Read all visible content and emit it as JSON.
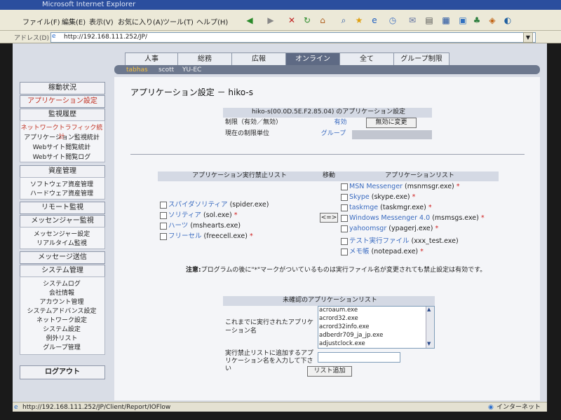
{
  "browser": {
    "title": "Microsoft Internet Explorer",
    "menu": [
      "ファイル(F)",
      "編集(E)",
      "表示(V)",
      "お気に入り(A)",
      "ツール(T)",
      "ヘルプ(H)"
    ],
    "address_label": "アドレス(D)",
    "address": "http://192.168.111.252/JP/",
    "status_url": "http://192.168.111.252/JP/Client/Report/IOFlow",
    "status_zone": "インターネット"
  },
  "tabs": [
    "人事",
    "総務",
    "広報",
    "オンライン",
    "全て",
    "グループ制限"
  ],
  "active_tab": 3,
  "subtabs": [
    "tabhas",
    "scott",
    "YU-EC"
  ],
  "sidebar": {
    "sections": [
      {
        "head": "稼動状況",
        "items": []
      },
      {
        "head": "アプリケーション設定",
        "items": [],
        "red": true
      },
      {
        "head": "監視履歴",
        "items": [
          "ネットワークトラフィック統計",
          "アプリケーション監視統計",
          "Webサイト閲覧統計",
          "Webサイト閲覧ログ"
        ]
      },
      {
        "head": "資産管理",
        "items": [
          "ソフトウェア資産管理",
          "ハードウェア資産管理"
        ]
      },
      {
        "head": "リモート監視",
        "items": []
      },
      {
        "head": "メッセンジャー監視",
        "items": [
          "メッセンジャー設定",
          "リアルタイム監視"
        ]
      },
      {
        "head": "メッセージ送信",
        "items": []
      },
      {
        "head": "システム管理",
        "items": [
          "システムログ",
          "会社情報",
          "アカウント管理",
          "システムアドバンス設定",
          "ネットワーク設定",
          "システム設定",
          "例外リスト",
          "グループ管理"
        ]
      }
    ],
    "logout": "ログアウト"
  },
  "page": {
    "title": "アプリケーション設定 － hiko-s",
    "settings_header": "hiko-s(00.0D.5E.F2.85.04) のアプリケーション設定",
    "limit_label": "制限（有効／無効）",
    "limit_value": "有効",
    "disable_button": "無効に変更",
    "unit_label": "現在の制限単位",
    "unit_value": "グループ",
    "blocked_header": "アプリケーション実行禁止リスト",
    "move_header": "移動",
    "apps_header": "アプリケーションリスト",
    "move_button": "<=>",
    "blocked": [
      {
        "name": "スパイダソリティア",
        "exe": "(spider.exe)",
        "star": false
      },
      {
        "name": "ソリティア",
        "exe": "(sol.exe)",
        "star": true
      },
      {
        "name": "ハーツ",
        "exe": "(mshearts.exe)",
        "star": false
      },
      {
        "name": "フリーセル",
        "exe": "(freecell.exe)",
        "star": true
      }
    ],
    "apps": [
      {
        "name": "MSN Messenger",
        "exe": "(msnmsgr.exe)",
        "star": true
      },
      {
        "name": "Skype",
        "exe": "(skype.exe)",
        "star": true
      },
      {
        "name": "taskmge",
        "exe": "(taskmgr.exe)",
        "star": true
      },
      {
        "name": "Windows Messenger 4.0",
        "exe": "(msmsgs.exe)",
        "star": true
      },
      {
        "name": "yahoomsgr",
        "exe": "(ypagerj.exe)",
        "star": true
      },
      {
        "name": "テスト実行ファイル",
        "exe": "(xxx_test.exe)",
        "star": false
      },
      {
        "name": "メモ帳",
        "exe": "(notepad.exe)",
        "star": true
      }
    ],
    "note_label": "注意:",
    "note_text": "プログラムの後に\"*\"マークがついているものは実行ファイル名が変更されても禁止設定は有効です。",
    "unconfirmed_header": "未確認のアプリケーションリスト",
    "executed_label": "これまでに実行されたアプリケーション名",
    "executed_list": [
      "acroaum.exe",
      "acrord32.exe",
      "acrord32info.exe",
      "adberdr709_ja_jp.exe",
      "adjustclock.exe"
    ],
    "add_label": "実行禁止リストに追加するアプリケーション名を入力して下さい",
    "add_input": "",
    "add_button": "リスト追加"
  }
}
